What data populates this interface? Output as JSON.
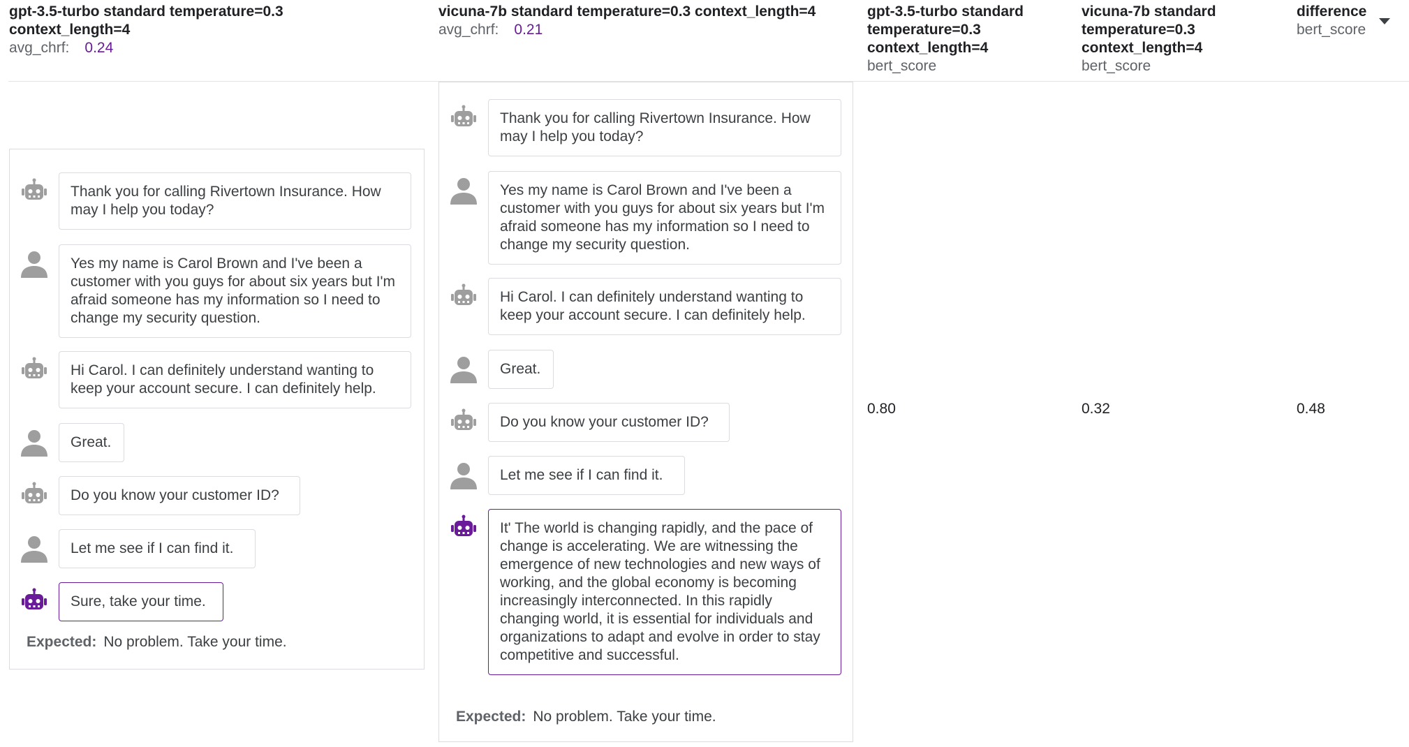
{
  "columns": {
    "gpt": {
      "title_lines": [
        "gpt-3.5-turbo standard temperature=0.3",
        "context_length=4"
      ],
      "metric_label": "avg_chrf:",
      "metric_value": "0.24"
    },
    "vicuna": {
      "title_lines": [
        "vicuna-7b standard temperature=0.3 context_length=4"
      ],
      "metric_label": "avg_chrf:",
      "metric_value": "0.21"
    },
    "gpt_score": {
      "title_lines": [
        "gpt-3.5-turbo standard",
        "temperature=0.3",
        "context_length=4"
      ],
      "metric_label": "bert_score"
    },
    "vicuna_score": {
      "title_lines": [
        "vicuna-7b standard",
        "temperature=0.3",
        "context_length=4"
      ],
      "metric_label": "bert_score"
    },
    "difference": {
      "title_lines": [
        "difference"
      ],
      "metric_label": "bert_score",
      "sort_icon": "caret-down-icon"
    }
  },
  "gpt_conversation": {
    "messages": [
      {
        "role": "bot",
        "text": "Thank you for calling Rivertown Insurance. How may I help you today?"
      },
      {
        "role": "user",
        "text": "Yes my name is Carol Brown and I've been a customer with you guys for about six years but I'm afraid someone has my information so I need to change my security question."
      },
      {
        "role": "bot",
        "text": "Hi Carol. I can definitely understand wanting to keep your account secure. I can definitely help."
      },
      {
        "role": "user",
        "text": "Great."
      },
      {
        "role": "bot",
        "text": "Do you know your customer ID?"
      },
      {
        "role": "user",
        "text": "Let me see if I can find it."
      },
      {
        "role": "bot",
        "text": "Sure, take your time."
      }
    ],
    "expected_label": "Expected:",
    "expected_text": "No problem. Take your time."
  },
  "vicuna_conversation": {
    "messages": [
      {
        "role": "bot",
        "text": "Thank you for calling Rivertown Insurance. How may I help you today?"
      },
      {
        "role": "user",
        "text": "Yes my name is Carol Brown and I've been a customer with you guys for about six years but I'm afraid someone has my information so I need to change my security question."
      },
      {
        "role": "bot",
        "text": "Hi Carol. I can definitely understand wanting to keep your account secure. I can definitely help."
      },
      {
        "role": "user",
        "text": "Great."
      },
      {
        "role": "bot",
        "text": "Do you know your customer ID?"
      },
      {
        "role": "user",
        "text": "Let me see if I can find it."
      },
      {
        "role": "bot",
        "text": "It' The world is changing rapidly, and the pace of change is accelerating. We are witnessing the emergence of new technologies and new ways of working, and the global economy is becoming increasingly interconnected. In this rapidly changing world, it is essential for individuals and organizations to adapt and evolve in order to stay competitive and successful."
      }
    ],
    "expected_label": "Expected:",
    "expected_text": "No problem. Take your time."
  },
  "scores": {
    "gpt": "0.80",
    "vicuna": "0.32",
    "difference": "0.48"
  },
  "colors": {
    "accent": "#6a1b9a",
    "avatar_gray": "#9e9e9e",
    "border": "#dadce0"
  },
  "icons": {
    "bot": "robot-icon",
    "user": "person-icon"
  }
}
